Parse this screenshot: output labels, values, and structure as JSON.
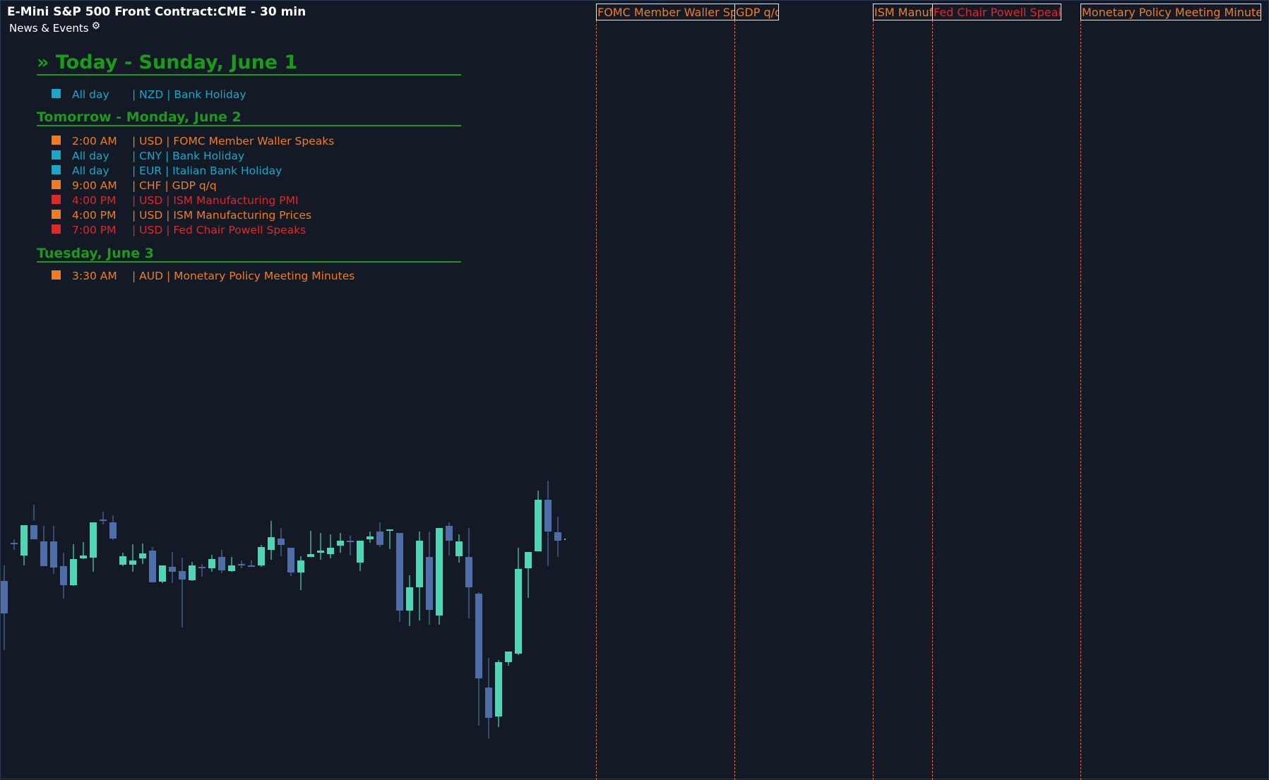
{
  "chart": {
    "title": "E-Mini S&P 500 Front Contract:CME - 30 min",
    "indicator": "News & Events",
    "settings_icon": "gear-icon"
  },
  "colors": {
    "background": "#131a26",
    "header_green": "#1c9a1c",
    "medium_impact": "#f07d22",
    "holiday": "#17a8c9",
    "high_impact": "#d92b2b",
    "candle_up": "#4fd6b6",
    "candle_down": "#4f6da6",
    "event_line": "#e0713a"
  },
  "days": [
    {
      "header": "» Today - Sunday, June 1",
      "events": [
        {
          "time": "All day",
          "text": "| NZD | Bank Holiday",
          "impact": "holiday"
        }
      ]
    },
    {
      "header": "Tomorrow - Monday, June 2",
      "events": [
        {
          "time": "2:00 AM",
          "text": "| USD | FOMC Member Waller Speaks",
          "impact": "medium"
        },
        {
          "time": "All day",
          "text": "| CNY | Bank Holiday",
          "impact": "holiday"
        },
        {
          "time": "All day",
          "text": "| EUR | Italian Bank Holiday",
          "impact": "holiday"
        },
        {
          "time": "9:00 AM",
          "text": "| CHF | GDP q/q",
          "impact": "medium"
        },
        {
          "time": "4:00 PM",
          "text": "| USD | ISM Manufacturing PMI",
          "impact": "high"
        },
        {
          "time": "4:00 PM",
          "text": "| USD | ISM Manufacturing Prices",
          "impact": "medium"
        },
        {
          "time": "7:00 PM",
          "text": "| USD | Fed Chair Powell Speaks",
          "impact": "high"
        }
      ]
    },
    {
      "header": "Tuesday, June 3",
      "events": [
        {
          "time": "3:30 AM",
          "text": "| AUD | Monetary Policy Meeting Minutes",
          "impact": "medium"
        }
      ]
    }
  ],
  "chart_events": [
    {
      "label": "FOMC Member Waller Speaks",
      "impact": "medium"
    },
    {
      "label": "GDP q/q",
      "impact": "medium"
    },
    {
      "label": "ISM Manufacturing PMI",
      "impact": "medium"
    },
    {
      "label": "Fed Chair Powell Speaks",
      "impact": "high"
    },
    {
      "label": "Monetary Policy Meeting Minutes",
      "impact": "medium"
    }
  ],
  "chart_data": {
    "type": "candlestick",
    "title": "E-Mini S&P 500 Front Contract:CME - 30 min",
    "bars": [
      {
        "o": 62,
        "h": 40,
        "l": 160,
        "c": 108
      },
      {
        "o": 8,
        "h": 3,
        "l": 18,
        "c": 10
      },
      {
        "o": 26,
        "h": -1,
        "l": 40,
        "c": -17
      },
      {
        "o": -17,
        "h": -46,
        "l": -24,
        "c": 3
      },
      {
        "o": 6,
        "h": -16,
        "l": 32,
        "c": 41
      },
      {
        "o": 6,
        "h": -16,
        "l": 52,
        "c": 43
      },
      {
        "o": 41,
        "h": 22,
        "l": 87,
        "c": 68
      },
      {
        "o": 68,
        "h": 10,
        "l": 69,
        "c": 31
      },
      {
        "o": 30,
        "h": 7,
        "l": 31,
        "c": 26
      },
      {
        "o": 29,
        "h": -21,
        "l": 49,
        "c": -21
      },
      {
        "o": -25,
        "h": -36,
        "l": -18,
        "c": -25
      },
      {
        "o": -21,
        "h": -31,
        "l": 4,
        "c": 2
      },
      {
        "o": 39,
        "h": 22,
        "l": 41,
        "c": 27
      },
      {
        "o": 39,
        "h": 10,
        "l": 49,
        "c": 33
      },
      {
        "o": 30,
        "h": 9,
        "l": 38,
        "c": 23
      },
      {
        "o": 19,
        "h": 14,
        "l": 64,
        "c": 64
      },
      {
        "o": 63,
        "h": 44,
        "l": 65,
        "c": 40
      },
      {
        "o": 42,
        "h": 21,
        "l": 65,
        "c": 49
      },
      {
        "o": 48,
        "h": 29,
        "l": 128,
        "c": 60
      },
      {
        "o": 61,
        "h": 35,
        "l": 62,
        "c": 40
      },
      {
        "o": 42,
        "h": 38,
        "l": 56,
        "c": 42
      },
      {
        "o": 44,
        "h": 25,
        "l": 49,
        "c": 31
      },
      {
        "o": 28,
        "h": 18,
        "l": 51,
        "c": 47
      },
      {
        "o": 48,
        "h": 28,
        "l": 49,
        "c": 40
      },
      {
        "o": 38,
        "h": 33,
        "l": 44,
        "c": 38
      },
      {
        "o": 40,
        "h": 33,
        "l": 41,
        "c": 40
      },
      {
        "o": 40,
        "h": 11,
        "l": 42,
        "c": 14
      },
      {
        "o": 18,
        "h": -23,
        "l": 32,
        "c": 0
      },
      {
        "o": 2,
        "h": -13,
        "l": 27,
        "c": 11
      },
      {
        "o": 15,
        "h": 17,
        "l": 55,
        "c": 50
      },
      {
        "o": 50,
        "h": 27,
        "l": 75,
        "c": 33
      },
      {
        "o": 28,
        "h": -9,
        "l": 28,
        "c": 24
      },
      {
        "o": 22,
        "h": -6,
        "l": 32,
        "c": 19
      },
      {
        "o": 24,
        "h": -4,
        "l": 30,
        "c": 15
      },
      {
        "o": 12,
        "h": -6,
        "l": 22,
        "c": 5
      },
      {
        "o": 5,
        "h": -2,
        "l": 26,
        "c": 7
      },
      {
        "o": 36,
        "h": 6,
        "l": 48,
        "c": 5
      },
      {
        "o": 3,
        "h": -8,
        "l": 8,
        "c": -1
      },
      {
        "o": -8,
        "h": -21,
        "l": 14,
        "c": 11
      },
      {
        "o": -10,
        "h": -11,
        "l": 17,
        "c": -11
      },
      {
        "o": -6,
        "h": -3,
        "l": 120,
        "c": 104
      },
      {
        "o": 104,
        "h": 54,
        "l": 126,
        "c": 71
      },
      {
        "o": 71,
        "h": -8,
        "l": 118,
        "c": 5
      },
      {
        "o": 28,
        "h": -8,
        "l": 124,
        "c": 103
      },
      {
        "o": 111,
        "h": -2,
        "l": 124,
        "c": -13
      },
      {
        "o": -16,
        "h": -21,
        "l": 26,
        "c": 5
      },
      {
        "o": 27,
        "h": -4,
        "l": 36,
        "c": 6
      },
      {
        "o": 28,
        "h": -13,
        "l": 115,
        "c": 71
      },
      {
        "o": 80,
        "h": 78,
        "l": 267,
        "c": 200
      },
      {
        "o": 213,
        "h": 171,
        "l": 285,
        "c": 256
      },
      {
        "o": 254,
        "h": 174,
        "l": 269,
        "c": 177
      },
      {
        "o": 177,
        "h": 166,
        "l": 182,
        "c": 162
      },
      {
        "o": 165,
        "h": 15,
        "l": 167,
        "c": 45
      },
      {
        "o": 44,
        "h": 31,
        "l": 86,
        "c": 21
      },
      {
        "o": 20,
        "h": -66,
        "l": 20,
        "c": -53
      },
      {
        "o": -53,
        "h": -80,
        "l": 41,
        "c": -8
      },
      {
        "o": -7,
        "h": -29,
        "l": 28,
        "c": 5
      },
      {
        "o": 4,
        "h": 3,
        "l": 19,
        "c": 2
      }
    ]
  }
}
